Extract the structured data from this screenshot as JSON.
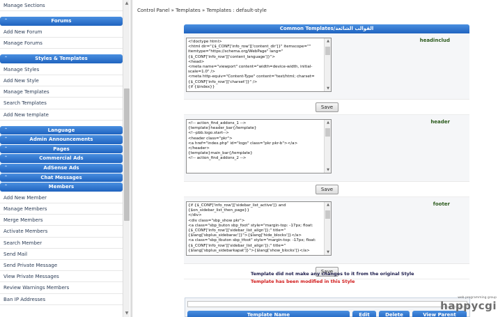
{
  "sidebar": {
    "top_items": [
      "Manage Sections"
    ],
    "sections": [
      {
        "title": "Forums",
        "items": [
          "Add New Forum",
          "Manage Forums"
        ]
      },
      {
        "title": "Styles & Templates",
        "items": [
          "Manage Styles",
          "Add New Style",
          "Manage Templates",
          "Search Templates",
          "Add New template"
        ]
      },
      {
        "title": "Language",
        "items": []
      },
      {
        "title": "Admin Announcements",
        "items": []
      },
      {
        "title": "Pages",
        "items": []
      },
      {
        "title": "Commercial Ads",
        "items": []
      },
      {
        "title": "AdSense Ads",
        "items": []
      },
      {
        "title": "Chat Messages",
        "items": []
      },
      {
        "title": "Members",
        "items": [
          "Add New Member",
          "Manage Members",
          "Merge Members",
          "Activate Members",
          "Search Member",
          "Send Mail",
          "Send Private Message",
          "View Private Messages",
          "Review Warnings Members",
          "Ban IP Addresses"
        ]
      }
    ]
  },
  "breadcrumb": {
    "items": [
      "Control Panel",
      "Templates",
      "Templates : default-style"
    ],
    "separator": " » "
  },
  "panel": {
    "title": "Common Templates/القوالب الشائعة",
    "templates": [
      {
        "name": "headinclud",
        "code": "<!doctype html>\n<html dir=\"{$_CONF['info_row']['content_dir']}\" itemscope=\"\" itemtype=\"https://schema.org/WebPage\" lang=\"{$_CONF['info_row']['content_language']}\">\n<head>\n<meta name=\"viewport\" content=\"width=device-width, initial-scale=1.0\" />\n<meta http-equiv=\"Content-Type\" content=\"text/html; charset={$_CONF['info_row']['charset']}\" />\n{if {$index}}",
        "save_label": "Save"
      },
      {
        "name": "header",
        "code": "<!-- action_find_addons_1 -->\n{template}header_bar{/template}\n<!--pbb.logo.start-->\n<header class=\"pkr\">\n<a href=\"index.php\" id=\"logo\" class=\"pkr pkr-b\"></a>\n</header>\n{template}main_bar{/template}\n<!-- action_find_addons_2 -->",
        "save_label": "Save"
      },
      {
        "name": "footer",
        "code": "{if {$_CONF['info_row']['sidebar_list_active']} and {$on_sidebar_list_then_page}}\n</div>\n<div class=\"sbp_show pkr\">\n<a class=\"sbp_buton sbp_foot\" style=\"margin-top: -17px; float: {$_CONF['info_row']['sidebar_list_align']};\" title=\"{$lang['sbplus_sidebarac']}\">{$lang['hide_blocks']}</a>\n<a class=\"sbp_tbuton sbp_tfoot\" style=\"margin-top: -17px; float: {$_CONF['info_row']['sidebar_list_align']};\" title=\"{$lang['sbplus_sidebarkapat']}\">{$lang['show_blocks']}</a>",
        "save_label": "Save"
      }
    ]
  },
  "legend": {
    "unchanged": "Template did not make any changes to it from the original Style",
    "modified": "Template has been modified in this Style"
  },
  "bottom_table": {
    "headers": [
      "Template Name",
      "Edit",
      "Delete",
      "View Parent"
    ]
  },
  "branding": {
    "tagline": "web programming group",
    "word": "happycgi"
  },
  "colors": {
    "header_blue": "#1f63bf",
    "modified_red": "#d01818",
    "template_name_green": "#2b5a1c"
  }
}
